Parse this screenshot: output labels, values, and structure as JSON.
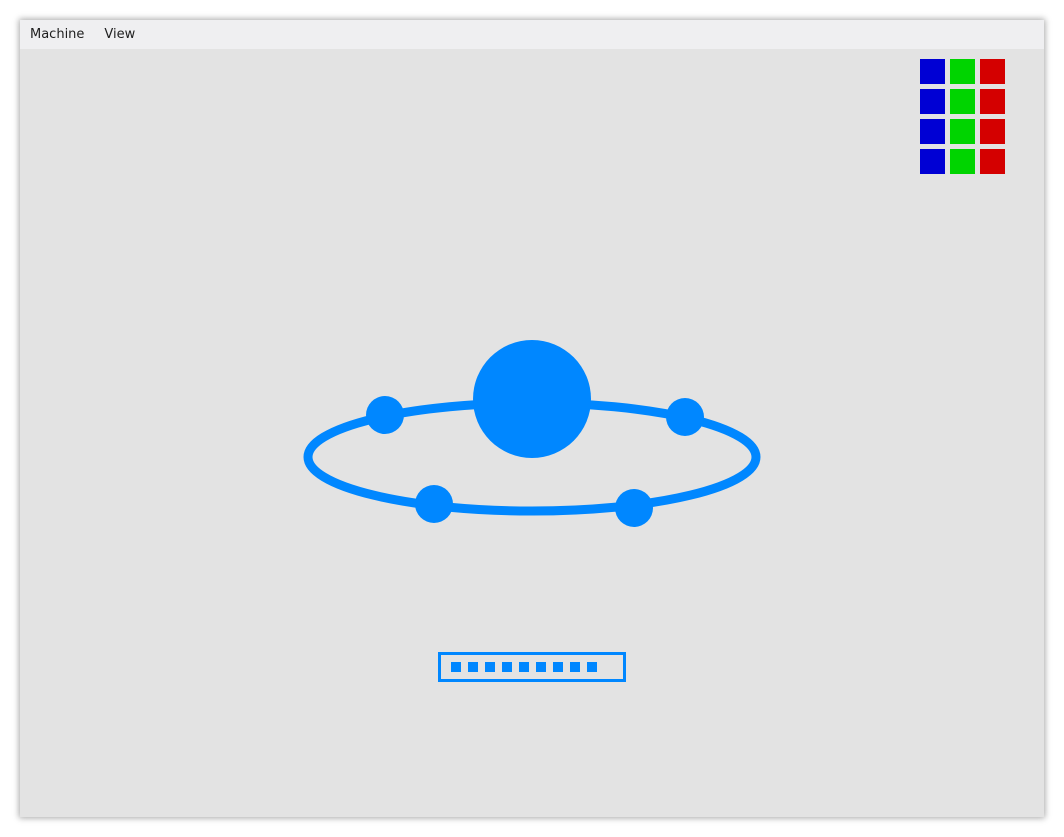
{
  "menubar": {
    "items": [
      {
        "label": "Machine"
      },
      {
        "label": "View"
      }
    ]
  },
  "indicators": {
    "columns": [
      "#0000d4",
      "#00d400",
      "#d40000"
    ],
    "rows": 4
  },
  "boot_logo": {
    "icon": "orbit-logo-icon",
    "color": "#0087ff",
    "satellites": 4
  },
  "boot_progress": {
    "icon": "progress-bar",
    "color": "#0087ff",
    "blocks_filled": 9
  },
  "colors": {
    "background": "#e3e3e3",
    "menubar": "#efeff1",
    "accent": "#0087ff"
  }
}
